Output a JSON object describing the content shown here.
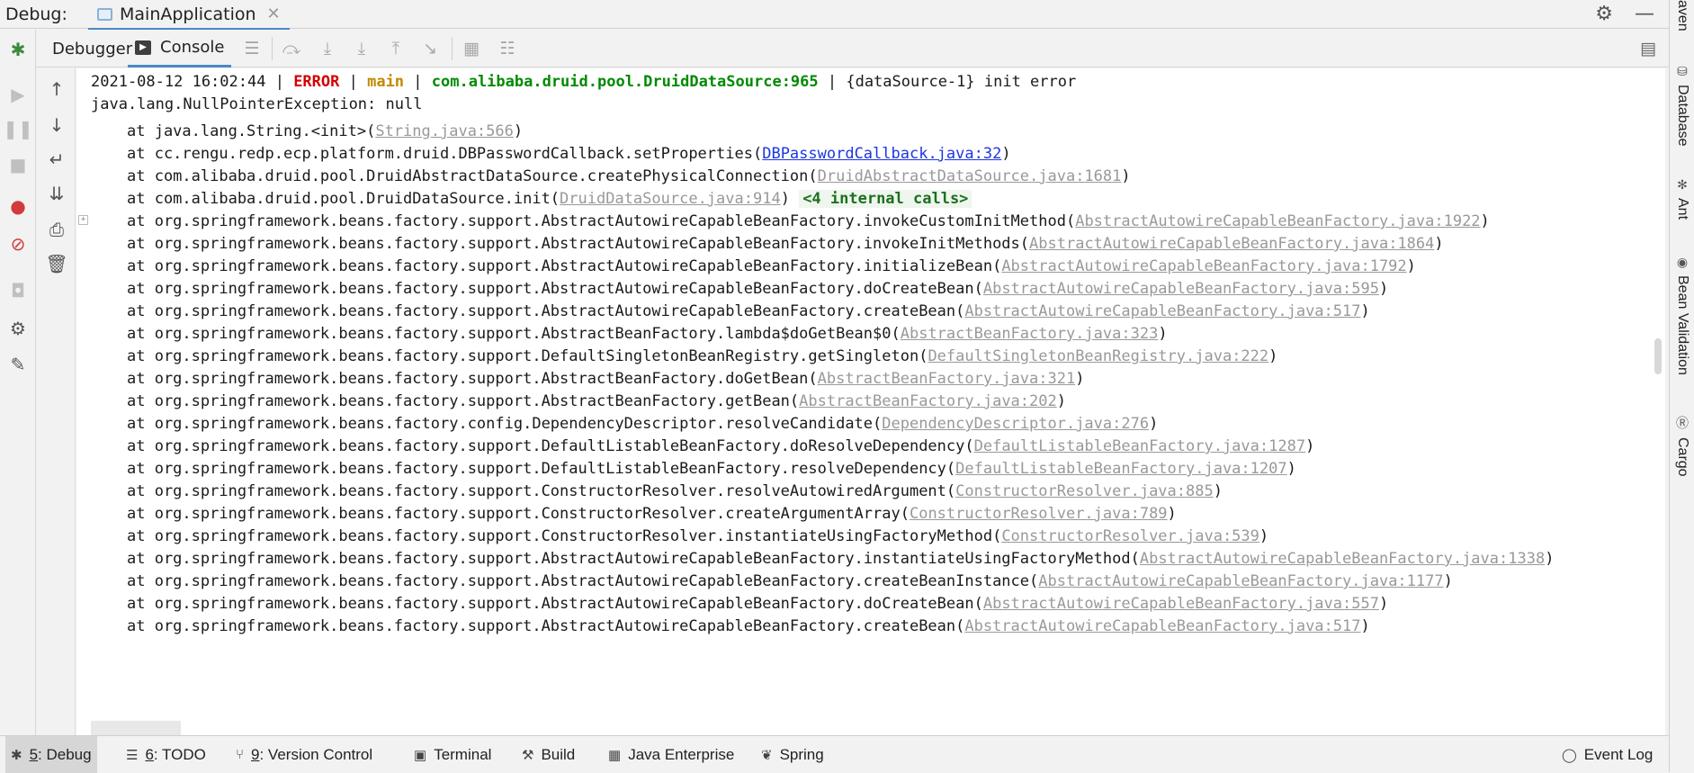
{
  "title_bar": {
    "label": "Debug:",
    "session_tab": "MainApplication"
  },
  "toolbar": {
    "debugger_tab": "Debugger",
    "console_tab": "Console"
  },
  "console": {
    "header": {
      "timestamp": "2021-08-12 16:02:44",
      "sep1": " | ",
      "level": "ERROR",
      "sep2": " | ",
      "thread": "main",
      "sep3": " | ",
      "logger": "com.alibaba.druid.pool.DruidDataSource:965",
      "message": " | {dataSource-1} init error"
    },
    "exception": "java.lang.NullPointerException: null",
    "frames": [
      {
        "method": "at java.lang.String.<init>(",
        "link": "String.java:566",
        "user": false
      },
      {
        "method": "at cc.rengu.redp.ecp.platform.druid.DBPasswordCallback.setProperties(",
        "link": "DBPasswordCallback.java:32",
        "user": true
      },
      {
        "method": "at com.alibaba.druid.pool.DruidAbstractDataSource.createPhysicalConnection(",
        "link": "DruidAbstractDataSource.java:1681",
        "user": false
      },
      {
        "method": "at com.alibaba.druid.pool.DruidDataSource.init(",
        "link": "DruidDataSource.java:914",
        "user": false,
        "internal": "<4 internal calls>"
      },
      {
        "method": "at org.springframework.beans.factory.support.AbstractAutowireCapableBeanFactory.invokeCustomInitMethod(",
        "link": "AbstractAutowireCapableBeanFactory.java:1922",
        "user": false
      },
      {
        "method": "at org.springframework.beans.factory.support.AbstractAutowireCapableBeanFactory.invokeInitMethods(",
        "link": "AbstractAutowireCapableBeanFactory.java:1864",
        "user": false
      },
      {
        "method": "at org.springframework.beans.factory.support.AbstractAutowireCapableBeanFactory.initializeBean(",
        "link": "AbstractAutowireCapableBeanFactory.java:1792",
        "user": false
      },
      {
        "method": "at org.springframework.beans.factory.support.AbstractAutowireCapableBeanFactory.doCreateBean(",
        "link": "AbstractAutowireCapableBeanFactory.java:595",
        "user": false
      },
      {
        "method": "at org.springframework.beans.factory.support.AbstractAutowireCapableBeanFactory.createBean(",
        "link": "AbstractAutowireCapableBeanFactory.java:517",
        "user": false
      },
      {
        "method": "at org.springframework.beans.factory.support.AbstractBeanFactory.lambda$doGetBean$0(",
        "link": "AbstractBeanFactory.java:323",
        "user": false
      },
      {
        "method": "at org.springframework.beans.factory.support.DefaultSingletonBeanRegistry.getSingleton(",
        "link": "DefaultSingletonBeanRegistry.java:222",
        "user": false
      },
      {
        "method": "at org.springframework.beans.factory.support.AbstractBeanFactory.doGetBean(",
        "link": "AbstractBeanFactory.java:321",
        "user": false
      },
      {
        "method": "at org.springframework.beans.factory.support.AbstractBeanFactory.getBean(",
        "link": "AbstractBeanFactory.java:202",
        "user": false
      },
      {
        "method": "at org.springframework.beans.factory.config.DependencyDescriptor.resolveCandidate(",
        "link": "DependencyDescriptor.java:276",
        "user": false
      },
      {
        "method": "at org.springframework.beans.factory.support.DefaultListableBeanFactory.doResolveDependency(",
        "link": "DefaultListableBeanFactory.java:1287",
        "user": false
      },
      {
        "method": "at org.springframework.beans.factory.support.DefaultListableBeanFactory.resolveDependency(",
        "link": "DefaultListableBeanFactory.java:1207",
        "user": false
      },
      {
        "method": "at org.springframework.beans.factory.support.ConstructorResolver.resolveAutowiredArgument(",
        "link": "ConstructorResolver.java:885",
        "user": false
      },
      {
        "method": "at org.springframework.beans.factory.support.ConstructorResolver.createArgumentArray(",
        "link": "ConstructorResolver.java:789",
        "user": false
      },
      {
        "method": "at org.springframework.beans.factory.support.ConstructorResolver.instantiateUsingFactoryMethod(",
        "link": "ConstructorResolver.java:539",
        "user": false
      },
      {
        "method": "at org.springframework.beans.factory.support.AbstractAutowireCapableBeanFactory.instantiateUsingFactoryMethod(",
        "link": "AbstractAutowireCapableBeanFactory.java:1338",
        "user": false
      },
      {
        "method": "at org.springframework.beans.factory.support.AbstractAutowireCapableBeanFactory.createBeanInstance(",
        "link": "AbstractAutowireCapableBeanFactory.java:1177",
        "user": false
      },
      {
        "method": "at org.springframework.beans.factory.support.AbstractAutowireCapableBeanFactory.doCreateBean(",
        "link": "AbstractAutowireCapableBeanFactory.java:557",
        "user": false
      },
      {
        "method": "at org.springframework.beans.factory.support.AbstractAutowireCapableBeanFactory.createBean(",
        "link": "AbstractAutowireCapableBeanFactory.java:517",
        "user": false
      }
    ]
  },
  "right_tabs": [
    "aven",
    "Database",
    "Ant",
    "Bean Validation",
    "Cargo"
  ],
  "status_bar": {
    "debug": {
      "num": "5",
      "label": ": Debug"
    },
    "todo": {
      "num": "6",
      "label": ": TODO"
    },
    "vcs": {
      "num": "9",
      "label": ": Version Control"
    },
    "terminal": "Terminal",
    "build": "Build",
    "java_enterprise": "Java Enterprise",
    "spring": "Spring",
    "event_log": "Event Log"
  }
}
